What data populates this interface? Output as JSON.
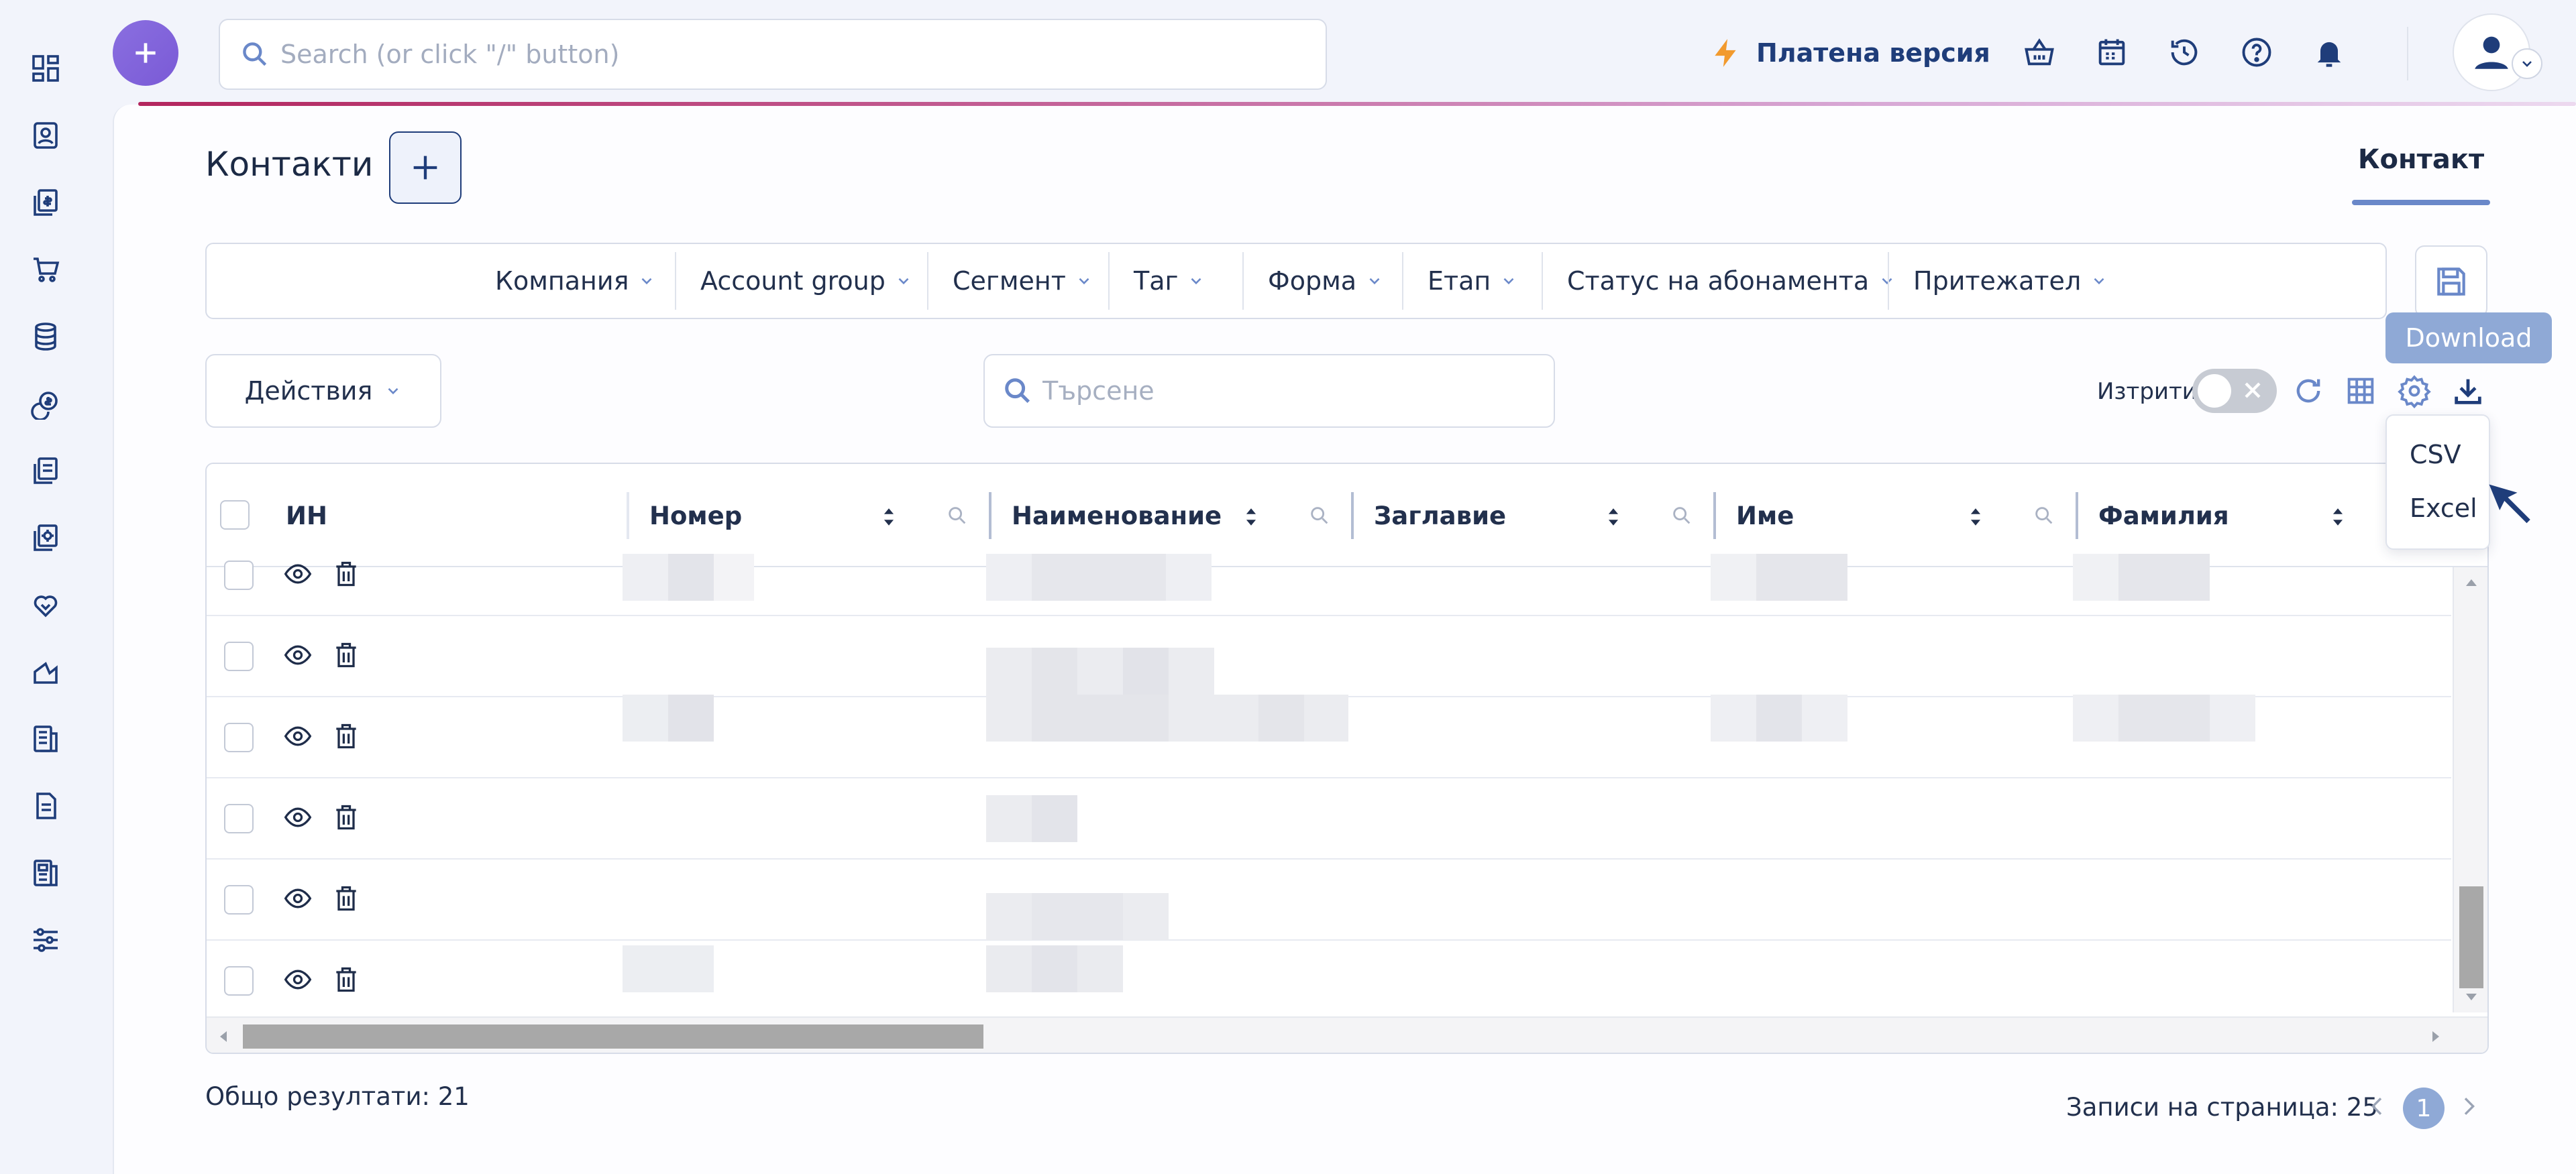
{
  "topbar": {
    "search_placeholder": "Search (or click \"/\" button)",
    "paid_version_label": "Платена версия"
  },
  "page": {
    "title": "Контакти",
    "tab_label": "Контакт"
  },
  "filters": [
    {
      "label": "Компания"
    },
    {
      "label": "Account group"
    },
    {
      "label": "Сегмент"
    },
    {
      "label": "Таг"
    },
    {
      "label": "Форма"
    },
    {
      "label": "Етап"
    },
    {
      "label": "Статус на абонамента"
    },
    {
      "label": "Притежател"
    }
  ],
  "toolbar": {
    "actions_label": "Действия",
    "search_placeholder": "Търсене",
    "deleted_label": "Изтрити",
    "deleted_toggle_on": false,
    "download_tooltip": "Download",
    "download_options": [
      "CSV",
      "Excel"
    ]
  },
  "table": {
    "columns": [
      "ИН",
      "Номер",
      "Наименование",
      "Заглавие",
      "Име",
      "Фамилия"
    ],
    "visible_rows": 6,
    "row_values_obscured": true
  },
  "footer": {
    "total_results": "Общо резултати: 21",
    "per_page": "Записи на страница: 25",
    "current_page": "1"
  },
  "colors": {
    "accent": "#1f3d7a",
    "fab": "#7a5ad6",
    "tooltip": "#8fa9d6",
    "lightning": "#f29a2e",
    "gradient_start": "#b3265e"
  },
  "icons": {
    "sidebar": [
      "dashboard-icon",
      "contact-card-icon",
      "invoices-icon",
      "cart-icon",
      "database-icon",
      "money-icon",
      "documents-icon",
      "settings-document-icon",
      "handshake-icon",
      "chart-icon",
      "reports-icon",
      "file-icon",
      "newspaper-icon",
      "sliders-icon"
    ],
    "topbar": [
      "lightning-icon",
      "basket-icon",
      "calendar-icon",
      "history-icon",
      "help-icon",
      "bell-icon",
      "user-icon"
    ]
  }
}
